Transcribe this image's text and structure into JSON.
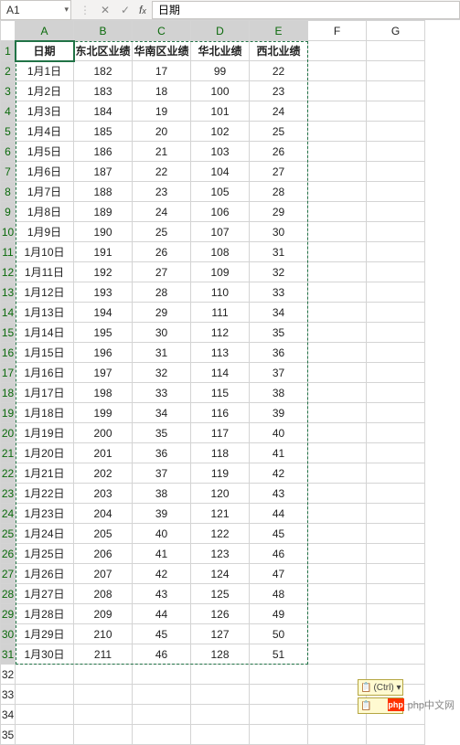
{
  "name_box": "A1",
  "formula_value": "日期",
  "columns": [
    "A",
    "B",
    "C",
    "D",
    "E",
    "F",
    "G"
  ],
  "selected_cols": [
    "A",
    "B",
    "C",
    "D",
    "E"
  ],
  "header_row": [
    "日期",
    "东北区业绩",
    "华南区业绩",
    "华北业绩",
    "西北业绩"
  ],
  "rows": [
    {
      "r": 2,
      "c": [
        "1月1日",
        "182",
        "17",
        "99",
        "22"
      ]
    },
    {
      "r": 3,
      "c": [
        "1月2日",
        "183",
        "18",
        "100",
        "23"
      ]
    },
    {
      "r": 4,
      "c": [
        "1月3日",
        "184",
        "19",
        "101",
        "24"
      ]
    },
    {
      "r": 5,
      "c": [
        "1月4日",
        "185",
        "20",
        "102",
        "25"
      ]
    },
    {
      "r": 6,
      "c": [
        "1月5日",
        "186",
        "21",
        "103",
        "26"
      ]
    },
    {
      "r": 7,
      "c": [
        "1月6日",
        "187",
        "22",
        "104",
        "27"
      ]
    },
    {
      "r": 8,
      "c": [
        "1月7日",
        "188",
        "23",
        "105",
        "28"
      ]
    },
    {
      "r": 9,
      "c": [
        "1月8日",
        "189",
        "24",
        "106",
        "29"
      ]
    },
    {
      "r": 10,
      "c": [
        "1月9日",
        "190",
        "25",
        "107",
        "30"
      ]
    },
    {
      "r": 11,
      "c": [
        "1月10日",
        "191",
        "26",
        "108",
        "31"
      ]
    },
    {
      "r": 12,
      "c": [
        "1月11日",
        "192",
        "27",
        "109",
        "32"
      ]
    },
    {
      "r": 13,
      "c": [
        "1月12日",
        "193",
        "28",
        "110",
        "33"
      ]
    },
    {
      "r": 14,
      "c": [
        "1月13日",
        "194",
        "29",
        "111",
        "34"
      ]
    },
    {
      "r": 15,
      "c": [
        "1月14日",
        "195",
        "30",
        "112",
        "35"
      ]
    },
    {
      "r": 16,
      "c": [
        "1月15日",
        "196",
        "31",
        "113",
        "36"
      ]
    },
    {
      "r": 17,
      "c": [
        "1月16日",
        "197",
        "32",
        "114",
        "37"
      ]
    },
    {
      "r": 18,
      "c": [
        "1月17日",
        "198",
        "33",
        "115",
        "38"
      ]
    },
    {
      "r": 19,
      "c": [
        "1月18日",
        "199",
        "34",
        "116",
        "39"
      ]
    },
    {
      "r": 20,
      "c": [
        "1月19日",
        "200",
        "35",
        "117",
        "40"
      ]
    },
    {
      "r": 21,
      "c": [
        "1月20日",
        "201",
        "36",
        "118",
        "41"
      ]
    },
    {
      "r": 22,
      "c": [
        "1月21日",
        "202",
        "37",
        "119",
        "42"
      ]
    },
    {
      "r": 23,
      "c": [
        "1月22日",
        "203",
        "38",
        "120",
        "43"
      ]
    },
    {
      "r": 24,
      "c": [
        "1月23日",
        "204",
        "39",
        "121",
        "44"
      ]
    },
    {
      "r": 25,
      "c": [
        "1月24日",
        "205",
        "40",
        "122",
        "45"
      ]
    },
    {
      "r": 26,
      "c": [
        "1月25日",
        "206",
        "41",
        "123",
        "46"
      ]
    },
    {
      "r": 27,
      "c": [
        "1月26日",
        "207",
        "42",
        "124",
        "47"
      ]
    },
    {
      "r": 28,
      "c": [
        "1月27日",
        "208",
        "43",
        "125",
        "48"
      ]
    },
    {
      "r": 29,
      "c": [
        "1月28日",
        "209",
        "44",
        "126",
        "49"
      ]
    },
    {
      "r": 30,
      "c": [
        "1月29日",
        "210",
        "45",
        "127",
        "50"
      ]
    },
    {
      "r": 31,
      "c": [
        "1月30日",
        "211",
        "46",
        "128",
        "51"
      ]
    }
  ],
  "extra_rows": [
    32,
    33,
    34,
    35
  ],
  "paste_options_label": "(Ctrl) ▾",
  "watermark": "php中文网",
  "active_cell": "A1",
  "selection_range": "A1:E31",
  "chart_data": {
    "type": "table",
    "title": "",
    "columns": [
      "日期",
      "东北区业绩",
      "华南区业绩",
      "华北业绩",
      "西北业绩"
    ],
    "data": [
      [
        "1月1日",
        182,
        17,
        99,
        22
      ],
      [
        "1月2日",
        183,
        18,
        100,
        23
      ],
      [
        "1月3日",
        184,
        19,
        101,
        24
      ],
      [
        "1月4日",
        185,
        20,
        102,
        25
      ],
      [
        "1月5日",
        186,
        21,
        103,
        26
      ],
      [
        "1月6日",
        187,
        22,
        104,
        27
      ],
      [
        "1月7日",
        188,
        23,
        105,
        28
      ],
      [
        "1月8日",
        189,
        24,
        106,
        29
      ],
      [
        "1月9日",
        190,
        25,
        107,
        30
      ],
      [
        "1月10日",
        191,
        26,
        108,
        31
      ],
      [
        "1月11日",
        192,
        27,
        109,
        32
      ],
      [
        "1月12日",
        193,
        28,
        110,
        33
      ],
      [
        "1月13日",
        194,
        29,
        111,
        34
      ],
      [
        "1月14日",
        195,
        30,
        112,
        35
      ],
      [
        "1月15日",
        196,
        31,
        113,
        36
      ],
      [
        "1月16日",
        197,
        32,
        114,
        37
      ],
      [
        "1月17日",
        198,
        33,
        115,
        38
      ],
      [
        "1月18日",
        199,
        34,
        116,
        39
      ],
      [
        "1月19日",
        200,
        35,
        117,
        40
      ],
      [
        "1月20日",
        201,
        36,
        118,
        41
      ],
      [
        "1月21日",
        202,
        37,
        119,
        42
      ],
      [
        "1月22日",
        203,
        38,
        120,
        43
      ],
      [
        "1月23日",
        204,
        39,
        121,
        44
      ],
      [
        "1月24日",
        205,
        40,
        122,
        45
      ],
      [
        "1月25日",
        206,
        41,
        123,
        46
      ],
      [
        "1月26日",
        207,
        42,
        124,
        47
      ],
      [
        "1月27日",
        208,
        43,
        125,
        48
      ],
      [
        "1月28日",
        209,
        44,
        126,
        49
      ],
      [
        "1月29日",
        210,
        45,
        127,
        50
      ],
      [
        "1月30日",
        211,
        46,
        128,
        51
      ]
    ]
  }
}
